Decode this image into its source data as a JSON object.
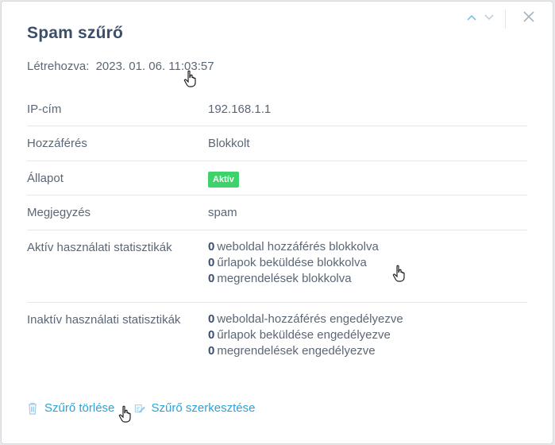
{
  "modal": {
    "title": "Spam szűrő",
    "created_label": "Létrehozva:",
    "created_value": "2023. 01. 06. 11:03:57",
    "nav": {
      "prev_icon": "chevron-up-icon",
      "next_icon": "chevron-down-icon",
      "close_icon": "close-icon"
    }
  },
  "details": [
    {
      "label": "IP-cím",
      "value": "192.168.1.1"
    },
    {
      "label": "Hozzáférés",
      "value": "Blokkolt"
    },
    {
      "label": "Állapot",
      "badge": "Aktív"
    },
    {
      "label": "Megjegyzés",
      "value": "spam"
    }
  ],
  "stats": {
    "active": {
      "label": "Aktív használati statisztikák",
      "items": [
        {
          "count": "0",
          "text": "weboldal hozzáférés blokkolva"
        },
        {
          "count": "0",
          "text": "űrlapok beküldése blokkolva"
        },
        {
          "count": "0",
          "text": "megrendelések blokkolva"
        }
      ]
    },
    "inactive": {
      "label": "Inaktív használati statisztikák",
      "items": [
        {
          "count": "0",
          "text": "weboldal-hozzáférés engedélyezve"
        },
        {
          "count": "0",
          "text": "űrlapok beküldése engedélyezve"
        },
        {
          "count": "0",
          "text": "megrendelések engedélyezve"
        }
      ]
    }
  },
  "actions": {
    "delete_label": "Szűrő törlése",
    "delete_icon": "trash-icon",
    "edit_label": "Szűrő szerkesztése",
    "edit_icon": "edit-icon"
  },
  "colors": {
    "accent": "#2ea1d8",
    "status_active": "#3ed36a",
    "title": "#3b4f6b"
  }
}
